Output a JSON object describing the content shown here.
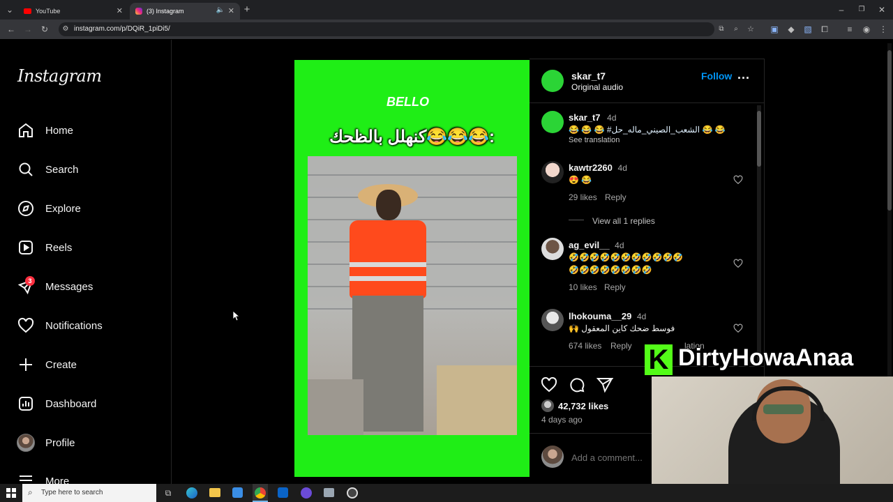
{
  "browser": {
    "tabs": [
      {
        "title": "YouTube",
        "active": false
      },
      {
        "title": "(3) Instagram",
        "active": true
      }
    ],
    "url": "instagram.com/p/DQiR_1piDi5/"
  },
  "instagram": {
    "logo": "Instagram",
    "nav": [
      {
        "label": "Home",
        "icon": "home-icon"
      },
      {
        "label": "Search",
        "icon": "search-icon"
      },
      {
        "label": "Explore",
        "icon": "compass-icon"
      },
      {
        "label": "Reels",
        "icon": "reels-icon"
      },
      {
        "label": "Messages",
        "icon": "messenger-icon"
      },
      {
        "label": "Notifications",
        "icon": "heart-icon"
      },
      {
        "label": "Create",
        "icon": "plus-icon"
      },
      {
        "label": "Dashboard",
        "icon": "dashboard-icon"
      },
      {
        "label": "Profile",
        "icon": "avatar"
      },
      {
        "label": "More",
        "icon": "menu-icon"
      }
    ],
    "messages_badge": "3"
  },
  "post": {
    "video_brand": "BELLO",
    "video_caption": "كنهلل بالظحك😂😂😂:",
    "header": {
      "username": "skar_t7",
      "subtitle": "Original audio",
      "follow": "Follow",
      "more": "..."
    },
    "caption": {
      "username": "skar_t7",
      "time": "4d",
      "text": "😂 😂 😂 #الشعب_الصيني_ماله_حل 😂 😂",
      "see_translation": "See translation"
    },
    "comments": [
      {
        "username": "kawtr2260",
        "time": "4d",
        "text": "😍 😂",
        "likes": "29 likes",
        "reply": "Reply",
        "view_replies": "View all 1 replies"
      },
      {
        "username": "ag_evil__",
        "time": "4d",
        "text_line1": "🤣🤣🤣🤣🤣🤣🤣🤣🤣🤣🤣",
        "text_line2": "🤣🤣🤣🤣🤣🤣🤣🤣",
        "likes": "10 likes",
        "reply": "Reply"
      },
      {
        "username": "lhokouma__29",
        "time": "4d",
        "text": "🙌 فوسط ضحك كاين المعقول",
        "likes": "674 likes",
        "reply": "Reply",
        "see_translation_fragment": "lation"
      }
    ],
    "likes_count": "42,732 likes",
    "posted": "4 days ago",
    "add_comment_placeholder": "Add a comment..."
  },
  "overlay": {
    "channel_name": "DirtyHowaAnaa",
    "badge_letter": "K"
  },
  "taskbar": {
    "search_placeholder": "Type here to search"
  },
  "colors": {
    "accent_blue": "#0095f6",
    "video_green": "#1fee16",
    "badge_red": "#ff3040",
    "bello_green": "#36d94c",
    "link_blue": "#e0f1ff"
  }
}
